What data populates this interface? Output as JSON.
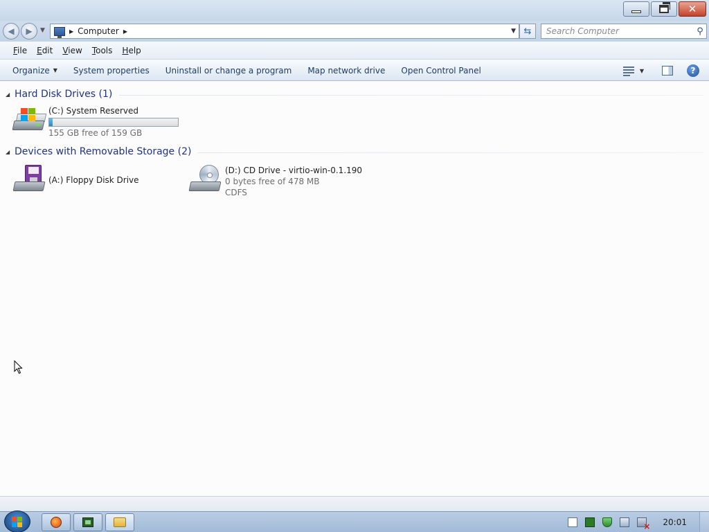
{
  "window": {
    "controls": {
      "minimize_icon": "minimize-icon",
      "restore_icon": "restore-icon",
      "close_icon": "close-icon"
    }
  },
  "address": {
    "crumbs": [
      "Computer"
    ],
    "search_placeholder": "Search Computer"
  },
  "menu": {
    "items": [
      {
        "accel": "F",
        "rest": "ile"
      },
      {
        "accel": "E",
        "rest": "dit"
      },
      {
        "accel": "V",
        "rest": "iew"
      },
      {
        "accel": "T",
        "rest": "ools"
      },
      {
        "accel": "H",
        "rest": "elp"
      }
    ]
  },
  "commands": {
    "organize": "Organize",
    "system_properties": "System properties",
    "uninstall": "Uninstall or change a program",
    "map_drive": "Map network drive",
    "control_panel": "Open Control Panel",
    "help_label": "?"
  },
  "groups": {
    "hdd": {
      "title": "Hard Disk Drives (1)",
      "drives": [
        {
          "name": "(C:) System Reserved",
          "free_text": "155 GB free of 159 GB",
          "used_fraction": 0.025,
          "icon": "hard-drive-icon"
        }
      ]
    },
    "removable": {
      "title": "Devices with Removable Storage (2)",
      "drives": [
        {
          "name": "(A:) Floppy Disk Drive",
          "icon": "floppy-drive-icon"
        },
        {
          "name": "(D:) CD Drive - virtio-win-0.1.190",
          "free_text": "0 bytes free of 478 MB",
          "fs": "CDFS",
          "icon": "cd-drive-icon"
        }
      ]
    }
  },
  "taskbar": {
    "buttons": [
      "firefox-icon",
      "virtual-machine-icon",
      "folder-icon"
    ],
    "tray_icons": [
      "document-icon",
      "vm-tray-icon",
      "shield-icon",
      "network-icon",
      "volume-muted-icon"
    ],
    "clock": "20:01"
  }
}
